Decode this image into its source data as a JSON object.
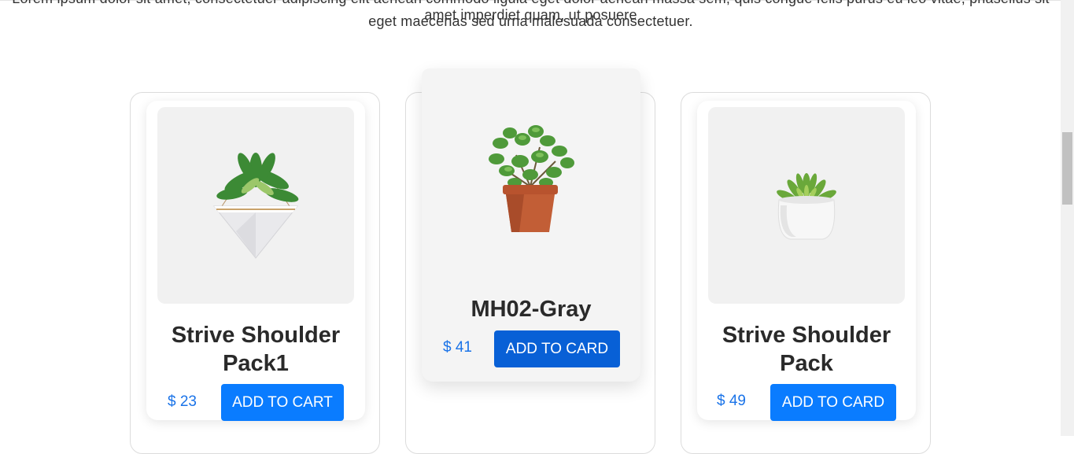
{
  "intro": {
    "line1": "Lorem ipsum dolor sit amet, consectetuer adipiscing elit aenean commodo ligula eget dolor aenean massa sem, quis congue felis purus eu leo vitae, phasellus sit amet imperdiet quam, ut posuere",
    "line2": "eget maecenas sed urna malesuada consectetuer."
  },
  "products": [
    {
      "title": "Strive Shoulder Pack1",
      "price": "$ 23",
      "button": "ADD TO CART",
      "image": "hanging-pyramid-planter-icon"
    },
    {
      "title": "MH02-Gray",
      "price": "$ 41",
      "button": "ADD TO CARD",
      "image": "jade-plant-terracotta-pot-icon"
    },
    {
      "title": "Strive Shoulder Pack",
      "price": "$ 49",
      "button": "ADD TO CARD",
      "image": "succulent-white-pot-icon"
    }
  ],
  "colors": {
    "accent": "#0a7cff",
    "price": "#1a73e8"
  }
}
